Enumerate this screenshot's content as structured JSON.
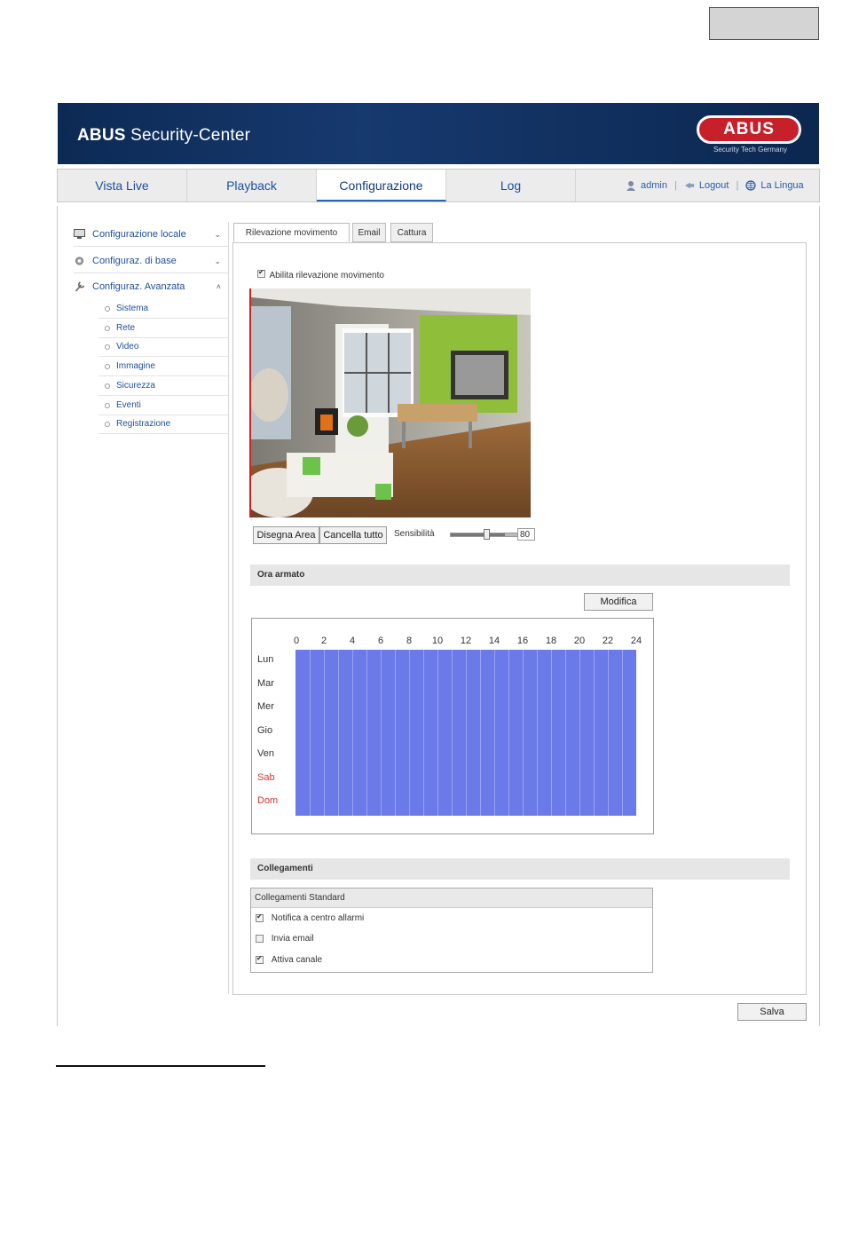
{
  "app": {
    "title_bold": "ABUS",
    "title_rest": " Security-Center",
    "logo_text": "ABUS",
    "logo_sub": "Security Tech Germany"
  },
  "nav": {
    "tabs": [
      {
        "label": "Vista Live"
      },
      {
        "label": "Playback"
      },
      {
        "label": "Configurazione"
      },
      {
        "label": "Log"
      }
    ],
    "user": "admin",
    "logout": "Logout",
    "language": "La Lingua"
  },
  "sidebar": {
    "groups": [
      {
        "label": "Configurazione locale",
        "chev": "⌄"
      },
      {
        "label": "Configuraz. di base",
        "chev": "⌄"
      },
      {
        "label": "Configuraz. Avanzata",
        "chev": "˄"
      }
    ],
    "sub_items": [
      {
        "label": "Sistema"
      },
      {
        "label": "Rete"
      },
      {
        "label": "Video"
      },
      {
        "label": "Immagine"
      },
      {
        "label": "Sicurezza"
      },
      {
        "label": "Eventi"
      },
      {
        "label": "Registrazione"
      }
    ]
  },
  "tabs": [
    {
      "label": "Rilevazione movimento"
    },
    {
      "label": "Email"
    },
    {
      "label": "Cattura"
    }
  ],
  "motion": {
    "enable_label": "Abilita rilevazione movimento",
    "enabled": true,
    "draw_area": "Disegna Area",
    "clear_all": "Cancella tutto",
    "sensitivity_label": "Sensibilità",
    "sensitivity_value": "80",
    "sensitivity_fraction": 0.8
  },
  "schedule": {
    "title": "Ora armato",
    "edit_button": "Modifica",
    "hours": [
      "0",
      "2",
      "4",
      "6",
      "8",
      "10",
      "12",
      "14",
      "16",
      "18",
      "20",
      "22",
      "24"
    ],
    "days": [
      {
        "label": "Lun",
        "weekend": false
      },
      {
        "label": "Mar",
        "weekend": false
      },
      {
        "label": "Mer",
        "weekend": false
      },
      {
        "label": "Gio",
        "weekend": false
      },
      {
        "label": "Ven",
        "weekend": false
      },
      {
        "label": "Sab",
        "weekend": true
      },
      {
        "label": "Dom",
        "weekend": true
      }
    ],
    "fill_color": "#6a7ae8",
    "weekend_color": "#e03030"
  },
  "links": {
    "title": "Collegamenti",
    "box_title": "Collegamenti Standard",
    "items": [
      {
        "label": "Notifica a centro allarmi",
        "checked": true
      },
      {
        "label": "Invia email",
        "checked": false
      },
      {
        "label": "Attiva canale",
        "checked": true
      }
    ]
  },
  "save_button": "Salva"
}
